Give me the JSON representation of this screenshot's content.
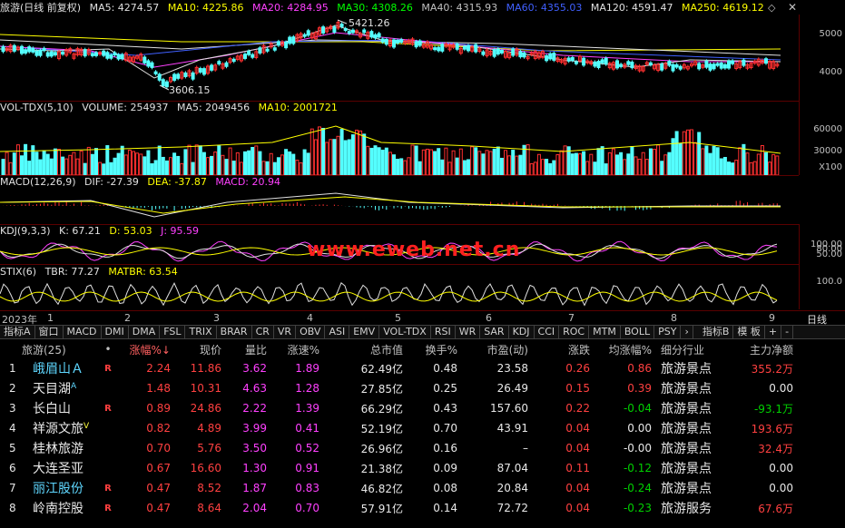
{
  "main_header": {
    "title": "旅游(日线 前复权)",
    "ma5": "MA5: 4274.57",
    "ma10": "MA10: 4225.86",
    "ma20": "MA20: 4284.95",
    "ma30": "MA30: 4308.26",
    "ma40": "MA40: 4315.93",
    "ma60": "MA60: 4355.03",
    "ma120": "MA120: 4591.47",
    "ma250": "MA250: 4619.12"
  },
  "main_axis": {
    "tick_5000": "5000",
    "tick_4000": "4000"
  },
  "annotations": {
    "high": "5421.26",
    "low": "3606.15"
  },
  "vol_header": {
    "title": "VOL-TDX(5,10)",
    "volume": "VOLUME: 254937",
    "ma5": "MA5: 2049456",
    "ma10": "MA10: 2001721"
  },
  "vol_axis": {
    "t1": "60000",
    "t2": "30000",
    "unit": "X100"
  },
  "macd_header": {
    "title": "MACD(12,26,9)",
    "dif": "DIF: -27.39",
    "dea": "DEA: -37.87",
    "macd": "MACD: 20.94"
  },
  "kdj_header": {
    "title": "KDJ(9,3,3)",
    "k": "K: 67.21",
    "d": "D: 53.03",
    "j": "J: 95.59"
  },
  "kdj_axis": {
    "t1": "100.00",
    "t2": "80.00",
    "t3": "50.00"
  },
  "stix_header": {
    "title": "STIX(6)",
    "tbr": "TBR: 77.27",
    "matbr": "MATBR: 63.54"
  },
  "stix_axis": {
    "t1": "100.0"
  },
  "time_axis": {
    "year": "2023年",
    "m1": "1",
    "m2": "2",
    "m3": "3",
    "m4": "4",
    "m5": "5",
    "m6": "6",
    "m7": "7",
    "m8": "8",
    "m9": "9",
    "period": "日线"
  },
  "watermark": "www.eweb.net.cn",
  "tabs": [
    "指标A",
    "窗口",
    "MACD",
    "DMI",
    "DMA",
    "FSL",
    "TRIX",
    "BRAR",
    "CR",
    "VR",
    "OBV",
    "ASI",
    "EMV",
    "VOL-TDX",
    "RSI",
    "WR",
    "SAR",
    "KDJ",
    "CCI",
    "ROC",
    "MTM",
    "BOLL",
    "PSY"
  ],
  "tabs_right": {
    "arrow": "›",
    "b": "指标B",
    "template": "模 板",
    "plus": "+",
    "minus": "-"
  },
  "table": {
    "headers": {
      "name": "旅游(25)",
      "dot": "•",
      "change": "涨幅%↓",
      "price": "现价",
      "ratio": "量比",
      "speed": "涨速%",
      "cap": "总市值",
      "turnover": "换手%",
      "pe": "市盈(动)",
      "updown": "涨跌",
      "avg": "均涨幅%",
      "industry": "细分行业",
      "flow": "主力净额"
    },
    "rows": [
      {
        "idx": "1",
        "name": "峨眉山Ａ",
        "mark": "",
        "r": "R",
        "change": "2.24",
        "price": "11.86",
        "ratio": "3.62",
        "speed": "1.89",
        "cap": "62.49亿",
        "turnover": "0.48",
        "pe": "23.58",
        "updown": "0.26",
        "avg": "0.86",
        "industry": "旅游景点",
        "flow": "355.2万"
      },
      {
        "idx": "2",
        "name": "天目湖",
        "mark": "A",
        "r": "",
        "change": "1.48",
        "price": "10.31",
        "ratio": "4.63",
        "speed": "1.28",
        "cap": "27.85亿",
        "turnover": "0.25",
        "pe": "26.49",
        "updown": "0.15",
        "avg": "0.39",
        "industry": "旅游景点",
        "flow": "0.00"
      },
      {
        "idx": "3",
        "name": "长白山",
        "mark": "",
        "r": "R",
        "change": "0.89",
        "price": "24.86",
        "ratio": "2.22",
        "speed": "1.39",
        "cap": "66.29亿",
        "turnover": "0.43",
        "pe": "157.60",
        "updown": "0.22",
        "avg": "-0.04",
        "industry": "旅游景点",
        "flow": "-93.1万"
      },
      {
        "idx": "4",
        "name": "祥源文旅",
        "mark": "V",
        "r": "",
        "change": "0.82",
        "price": "4.89",
        "ratio": "3.99",
        "speed": "0.41",
        "cap": "52.19亿",
        "turnover": "0.70",
        "pe": "43.91",
        "updown": "0.04",
        "avg": "0.00",
        "industry": "旅游景点",
        "flow": "193.6万"
      },
      {
        "idx": "5",
        "name": "桂林旅游",
        "mark": "",
        "r": "",
        "change": "0.70",
        "price": "5.76",
        "ratio": "3.50",
        "speed": "0.52",
        "cap": "26.96亿",
        "turnover": "0.16",
        "pe": "–",
        "updown": "0.04",
        "avg": "-0.00",
        "industry": "旅游景点",
        "flow": "32.4万"
      },
      {
        "idx": "6",
        "name": "大连圣亚",
        "mark": "",
        "r": "",
        "change": "0.67",
        "price": "16.60",
        "ratio": "1.30",
        "speed": "0.91",
        "cap": "21.38亿",
        "turnover": "0.09",
        "pe": "87.04",
        "updown": "0.11",
        "avg": "-0.12",
        "industry": "旅游景点",
        "flow": "0.00"
      },
      {
        "idx": "7",
        "name": "丽江股份",
        "mark": "",
        "r": "R",
        "change": "0.47",
        "price": "8.52",
        "ratio": "1.87",
        "speed": "0.83",
        "cap": "46.82亿",
        "turnover": "0.08",
        "pe": "20.84",
        "updown": "0.04",
        "avg": "-0.24",
        "industry": "旅游景点",
        "flow": "0.00"
      },
      {
        "idx": "8",
        "name": "岭南控股",
        "mark": "",
        "r": "R",
        "change": "0.47",
        "price": "8.64",
        "ratio": "2.04",
        "speed": "0.70",
        "cap": "57.91亿",
        "turnover": "0.14",
        "pe": "72.72",
        "updown": "0.04",
        "avg": "-0.23",
        "industry": "旅游服务",
        "flow": "67.6万"
      }
    ]
  }
}
